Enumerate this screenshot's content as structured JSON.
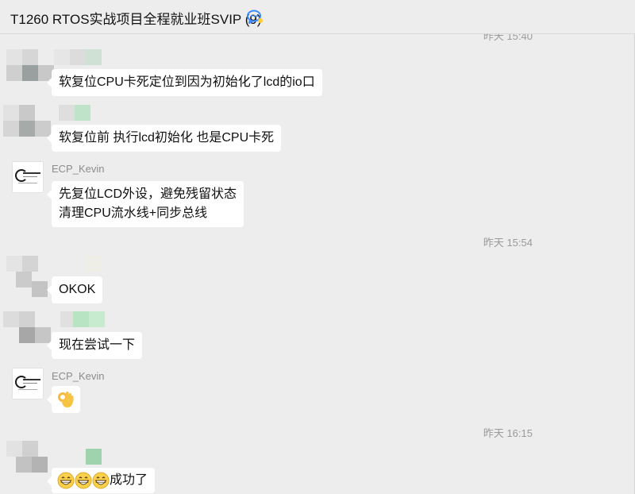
{
  "header": {
    "title": "T1260 RTOS实战项目全程就业班SVIP (9)",
    "chat_icon": "group-chat-icon"
  },
  "timestamps": [
    "昨天 15:40",
    "昨天 15:54",
    "昨天 16:15"
  ],
  "sender_name": "ECP_Kevin",
  "messages": {
    "m1": "软复位CPU卡死定位到因为初始化了lcd的io口",
    "m2": "软复位前 执行lcd初始化 也是CPU卡死",
    "m3_line1": "先复位LCD外设，避免残留状态",
    "m3_line2": "清理CPU流水线+同步总线",
    "m4": "OKOK",
    "m5": "现在尝试一下",
    "m6_icon": "ok-hand-emoji",
    "m7_icons": [
      "grin-emoji",
      "grin-emoji",
      "grin-emoji"
    ],
    "m7_text": "成功了"
  },
  "colors": {
    "background": "#ededed",
    "bubble": "#ffffff",
    "accent_icon": "#3d8bff"
  }
}
